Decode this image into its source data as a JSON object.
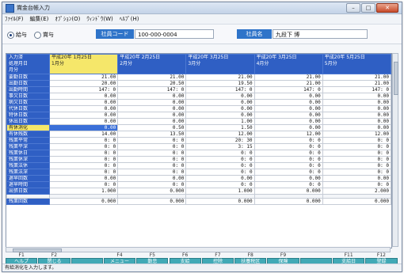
{
  "window": {
    "title": "賞金台帳入力",
    "min": "–",
    "max": "□",
    "close": "✕"
  },
  "menu": [
    "ﾌｧｲﾙ(F)",
    "編集(E)",
    "ｵﾌﾟｼｮﾝ(O)",
    "ｳｨﾝﾄﾞｳ(W)",
    "ﾍﾙﾌﾟ(H)"
  ],
  "header": {
    "radio_salary": "給与",
    "radio_bonus": "賞与",
    "emp_code_label": "社員コード",
    "emp_code_value": "100-000-0004",
    "emp_name_label": "社員名",
    "emp_name_value": "九段下 博"
  },
  "table": {
    "corner": "入力済\n処理月日\n月分",
    "columns": [
      {
        "date": "平成20年 1月25日",
        "month": "1月分"
      },
      {
        "date": "平成20年 2月25日",
        "month": "2月分"
      },
      {
        "date": "平成20年 3月25日",
        "month": "3月分"
      },
      {
        "date": "平成20年 3月25日",
        "month": "4月分"
      },
      {
        "date": "平成20年 5月25日",
        "month": "5月分"
      }
    ],
    "rows": [
      {
        "label": "要勤日数",
        "values": [
          "21.00",
          "21.00",
          "21.00",
          "21.00",
          "21.00"
        ]
      },
      {
        "label": "出勤日数",
        "values": [
          "20.00",
          "20.50",
          "19.50",
          "21.00",
          "21.00"
        ]
      },
      {
        "label": "出勤時間",
        "values": [
          "147:  0",
          "147:  0",
          "147:  0",
          "147:  0",
          "147:  0"
        ]
      },
      {
        "label": "事欠日数",
        "values": [
          "0.00",
          "0.00",
          "0.00",
          "0.00",
          "0.00"
        ]
      },
      {
        "label": "病欠日数",
        "values": [
          "0.00",
          "0.00",
          "0.00",
          "0.00",
          "0.00"
        ]
      },
      {
        "label": "代休日数",
        "values": [
          "0.00",
          "0.00",
          "0.00",
          "0.00",
          "0.00"
        ]
      },
      {
        "label": "特休日数",
        "values": [
          "0.00",
          "0.00",
          "0.00",
          "0.00",
          "0.00"
        ]
      },
      {
        "label": "休出日数",
        "values": [
          "0.00",
          "0.00",
          "1.00",
          "0.00",
          "0.00"
        ]
      },
      {
        "label": "有休消化",
        "values": [
          "0.00",
          "0.50",
          "1.50",
          "0.00",
          "0.00"
        ]
      },
      {
        "label": "有休残数",
        "values": [
          "14.00",
          "13.50",
          "12.00",
          "12.00",
          "12.00"
        ]
      },
      {
        "label": "残業平常",
        "values": [
          "0:  0",
          "0:  0",
          "20: 30",
          "0:  0",
          "0:  0"
        ]
      },
      {
        "label": "残業平深",
        "values": [
          "0:  0",
          "0:  0",
          "3: 15",
          "0:  0",
          "0:  0"
        ]
      },
      {
        "label": "残業休日",
        "values": [
          "0:  0",
          "0:  0",
          "0:  0",
          "0:  0",
          "0:  0"
        ]
      },
      {
        "label": "残業休深",
        "values": [
          "0:  0",
          "0:  0",
          "0:  0",
          "0:  0",
          "0:  0"
        ]
      },
      {
        "label": "残業法休",
        "values": [
          "0:  0",
          "0:  0",
          "0:  0",
          "0:  0",
          "0:  0"
        ]
      },
      {
        "label": "残業法深",
        "values": [
          "0:  0",
          "0:  0",
          "0:  0",
          "0:  0",
          "0:  0"
        ]
      },
      {
        "label": "遅早回数",
        "values": [
          "0.00",
          "0.00",
          "0.00",
          "0.00",
          "0.00"
        ]
      },
      {
        "label": "遅早時間",
        "values": [
          "0:  0",
          "0:  0",
          "0:  0",
          "0:  0",
          "0:  0"
        ]
      },
      {
        "label": "出張日数",
        "values": [
          "1.000",
          "0.000",
          "1.000",
          "0.000",
          "2.000"
        ]
      }
    ],
    "extra_row": {
      "label": "残業回数",
      "values": [
        "0.000",
        "0.000",
        "0.000",
        "0.000",
        "0.000"
      ]
    }
  },
  "fkeys": [
    {
      "num": "F1",
      "label": "ヘルプ"
    },
    {
      "num": "F2",
      "label": "閉じる"
    },
    {
      "num": "",
      "label": ""
    },
    {
      "num": "F4",
      "label": "メニュー"
    },
    {
      "num": "F5",
      "label": "勤怠"
    },
    {
      "num": "F6",
      "label": "支給"
    },
    {
      "num": "F7",
      "label": "控除"
    },
    {
      "num": "F8",
      "label": "扶養税区"
    },
    {
      "num": "F9",
      "label": "保険"
    },
    {
      "num": "",
      "label": ""
    },
    {
      "num": "F11",
      "label": "支給日"
    },
    {
      "num": "F12",
      "label": "登録"
    }
  ],
  "status": "有給消化を入力します。"
}
